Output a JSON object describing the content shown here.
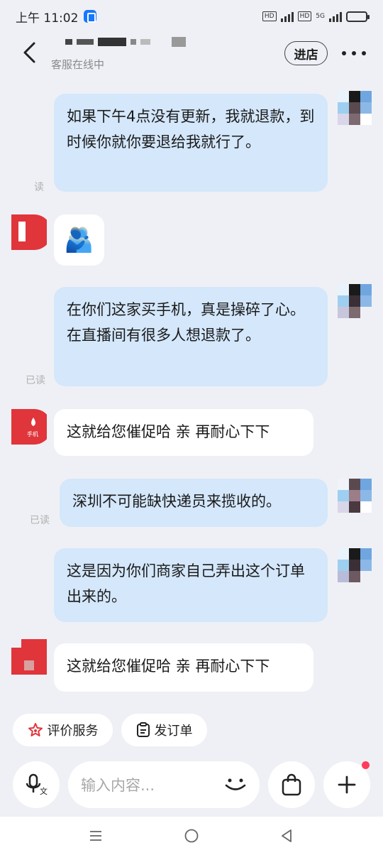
{
  "status_bar": {
    "time": "上午 11:02",
    "network": "5G",
    "hd_label": "HD"
  },
  "header": {
    "subtitle": "客服在线中",
    "enter_store_label": "进店"
  },
  "messages": [
    {
      "direction": "out",
      "text": "如果下午4点没有更新，我就退款，到时候你就你要退给我就行了。",
      "read": "读"
    },
    {
      "direction": "in",
      "type": "emoji",
      "emoji": "🫂"
    },
    {
      "direction": "out",
      "text": "在你们这家买手机，真是操碎了心。在直播间有很多人想退款了。",
      "read": "已读"
    },
    {
      "direction": "in",
      "text": "这就给您催促哈 亲 再耐心下下"
    },
    {
      "direction": "out",
      "text": "深圳不可能缺快递员来揽收的。",
      "read": "已读"
    },
    {
      "direction": "out",
      "text": "这是因为你们商家自己弄出这个订单出来的。",
      "read": ""
    },
    {
      "direction": "in",
      "text": "这就给您催促哈 亲 再耐心下下"
    }
  ],
  "shop_avatar_caption": "手机",
  "quick_actions": [
    {
      "label": "评价服务",
      "icon": "star-badge-icon"
    },
    {
      "label": "发订单",
      "icon": "order-clipboard-icon"
    }
  ],
  "input": {
    "placeholder": "输入内容..."
  },
  "colors": {
    "background": "#eff0f5",
    "outgoing_bubble": "#d4e7fb",
    "incoming_bubble": "#ffffff",
    "brand_red": "#e0353b",
    "notification_dot": "#ff3b5c"
  }
}
